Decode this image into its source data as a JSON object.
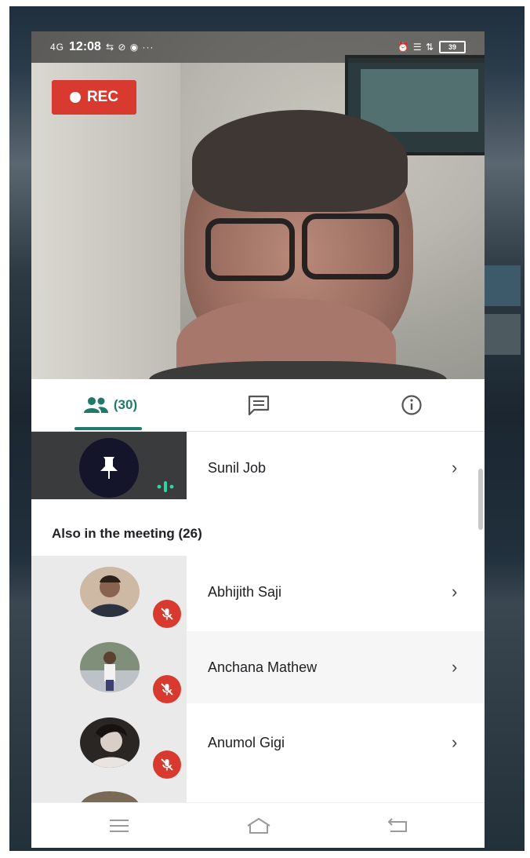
{
  "statusbar": {
    "time": "12:08",
    "left_icons": "⇆ ⊘ ◉ ···",
    "signal_label": "4G",
    "right_icons": "⏰ ☰ ⇅",
    "battery": "39"
  },
  "recording": {
    "label": "REC"
  },
  "tabs": {
    "people_count": "(30)"
  },
  "pinned": {
    "name": "Sunil Job"
  },
  "also_in_meeting": {
    "label": "Also in the meeting (26)"
  },
  "participants": [
    {
      "name": "Abhijith Saji"
    },
    {
      "name": "Anchana Mathew"
    },
    {
      "name": "Anumol Gigi"
    }
  ],
  "colors": {
    "accent": "#1f7a68",
    "rec_red": "#d93a2f",
    "mute_red": "#d93a2f"
  },
  "icons": {
    "tab_people": "people-icon",
    "tab_chat": "chat-icon",
    "tab_info": "info-icon",
    "pin": "pin-icon",
    "speaking": "speaking-icon",
    "muted": "mic-off-icon",
    "chevron": "chevron-right-icon",
    "nav_menu": "menu-icon",
    "nav_home": "home-icon",
    "nav_back": "back-icon"
  }
}
